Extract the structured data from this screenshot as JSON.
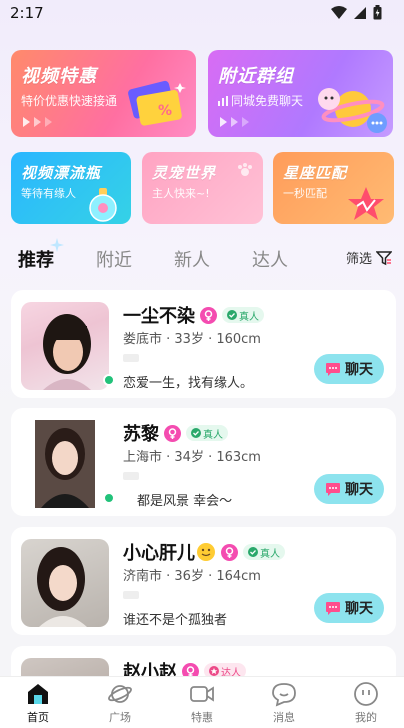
{
  "status": {
    "time": "2:17"
  },
  "promos": {
    "video_special": {
      "title": "视频特惠",
      "subtitle": "特价优惠快速接通",
      "coupon_text": "%"
    },
    "nearby_group": {
      "title": "附近群组",
      "subtitle": "同城免费聊天"
    },
    "drift_bottle": {
      "title": "视频漂流瓶",
      "subtitle": "等待有缘人"
    },
    "pet_world": {
      "title": "灵宠世界",
      "subtitle": "主人快来~!"
    },
    "horoscope": {
      "title": "星座匹配",
      "subtitle": "一秒匹配"
    }
  },
  "tabs": [
    "推荐",
    "附近",
    "新人",
    "达人"
  ],
  "filter_label": "筛选",
  "users": [
    {
      "name": "一尘不染",
      "badge": "真人",
      "info": "娄底市 · 33岁 · 160cm",
      "bio": "恋爱一生，找有缘人。",
      "chat": "聊天"
    },
    {
      "name": "苏黎",
      "badge": "真人",
      "info": "上海市 · 34岁 · 163cm",
      "bio": "都是风景  幸会～",
      "chat": "聊天"
    },
    {
      "name": "小心肝儿",
      "badge": "真人",
      "info": "济南市 · 36岁 · 164cm",
      "bio": "谁还不是个孤独者",
      "chat": "聊天"
    },
    {
      "name": "赵小赵",
      "badge": "达人"
    }
  ],
  "nav": [
    "首页",
    "广场",
    "特惠",
    "消息",
    "我的"
  ],
  "colors": {
    "accent": "#8de3ee",
    "online": "#22c27a",
    "gender": "#f44cb0"
  }
}
